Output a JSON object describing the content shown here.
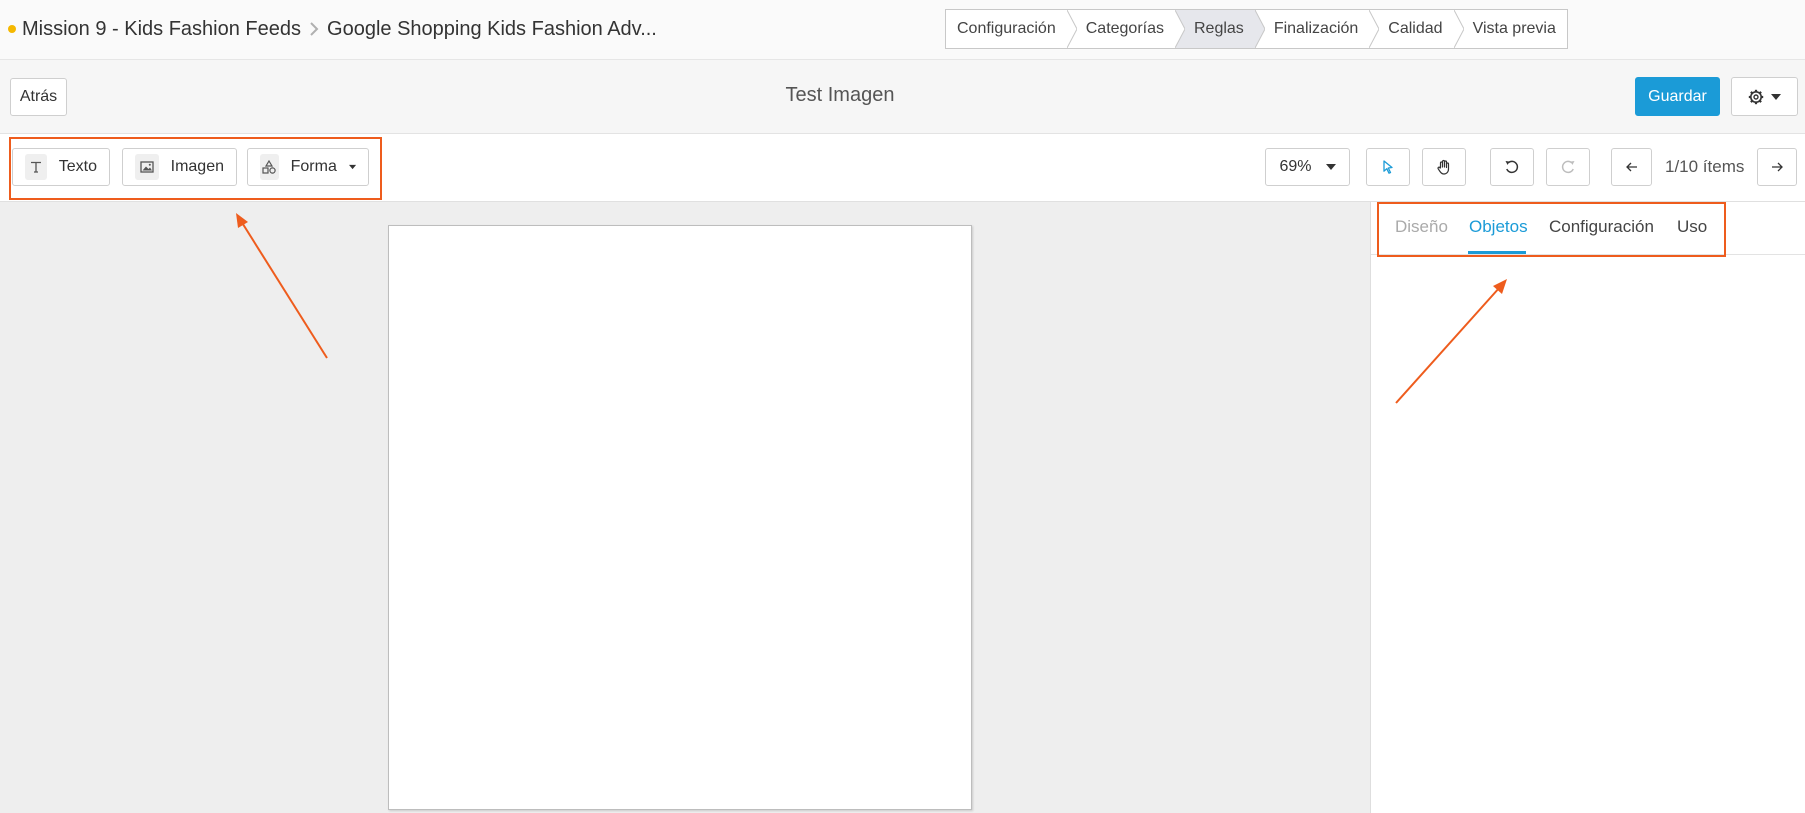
{
  "header": {
    "project": "Mission 9 - Kids Fashion Feeds",
    "feed": "Google Shopping Kids Fashion Adv...",
    "steps": [
      {
        "label": "Configuración"
      },
      {
        "label": "Categorías"
      },
      {
        "label": "Reglas",
        "active": true
      },
      {
        "label": "Finalización"
      },
      {
        "label": "Calidad"
      },
      {
        "label": "Vista previa"
      }
    ]
  },
  "bar2": {
    "back_label": "Atrás",
    "title": "Test Imagen",
    "save_label": "Guardar"
  },
  "toolbar": {
    "text_label": "Texto",
    "image_label": "Imagen",
    "shape_label": "Forma",
    "zoom": "69%",
    "counter": "1/10 ítems"
  },
  "panel": {
    "tabs": [
      {
        "label": "Diseño",
        "state": "disabled"
      },
      {
        "label": "Objetos",
        "state": "active"
      },
      {
        "label": "Configuración",
        "state": "normal"
      },
      {
        "label": "Uso",
        "state": "normal"
      }
    ]
  },
  "colors": {
    "accent": "#1b9bd7",
    "highlight": "#ee5c1d",
    "status_dot": "#f5b800"
  }
}
